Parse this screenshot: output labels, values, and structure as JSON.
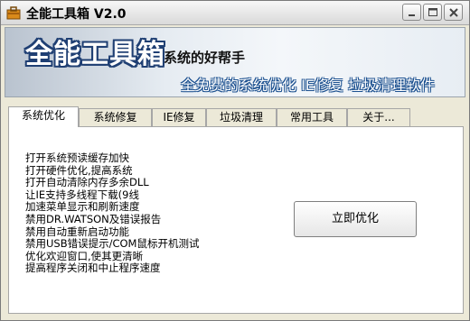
{
  "window": {
    "title": "全能工具箱 V2.0"
  },
  "titlebar": {
    "icon": "toolbox-icon",
    "buttons": [
      "minimize-icon",
      "maximize-icon",
      "close-icon"
    ]
  },
  "banner": {
    "title": "全能工具箱",
    "subtitle": "系统的好帮手",
    "slogan": "全免费的系统优化 IE修复 垃圾清理软件"
  },
  "tabs": [
    {
      "label": "系统优化",
      "active": true
    },
    {
      "label": "系统修复",
      "active": false
    },
    {
      "label": "IE修复",
      "active": false
    },
    {
      "label": "垃圾清理",
      "active": false
    },
    {
      "label": "常用工具",
      "active": false
    },
    {
      "label": "关于...",
      "active": false
    }
  ],
  "main": {
    "features": [
      "打开系统预读缓存加快",
      "打开硬件优化,提高系统",
      "打开自动清除内存多余DLL",
      "让IE支持多线程下载(9线",
      "加速菜单显示和刷新速度",
      "禁用DR.WATSON及错误报告",
      "禁用自动重新启动功能",
      "禁用USB错误提示/COM鼠标开机测试",
      "优化欢迎窗口,使其更清晰",
      "提高程序关闭和中止程序速度"
    ],
    "optimize_button": "立即优化"
  },
  "colors": {
    "banner_text_outline": "#1f3f73",
    "window_bg": "#ece9d8",
    "panel_bg": "#ffffff"
  }
}
